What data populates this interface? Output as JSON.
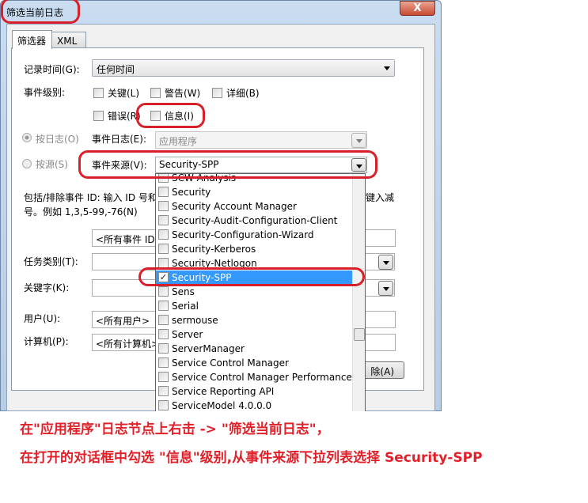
{
  "window": {
    "title": "筛选当前日志",
    "close_label": "X"
  },
  "tabs": [
    {
      "label": "筛选器",
      "active": true
    },
    {
      "label": "XML",
      "active": false
    }
  ],
  "filter": {
    "logged_label": "记录时间(G):",
    "logged_value": "任何时间",
    "level_label": "事件级别:",
    "levels": [
      {
        "label": "关键(L)",
        "checked": false
      },
      {
        "label": "警告(W)",
        "checked": false
      },
      {
        "label": "详细(B)",
        "checked": false
      },
      {
        "label": "错误(R)",
        "checked": false
      },
      {
        "label": "信息(I)",
        "checked": false
      }
    ],
    "by_log_label": "按日志(O)",
    "by_source_label": "按源(S)",
    "event_log_label": "事件日志(E):",
    "event_log_value": "应用程序",
    "event_source_label": "事件来源(V):",
    "event_source_value": "Security-SPP",
    "include_text_1": "包括/排除事件 ID: 输入 ID 号和",
    "include_text_1_tail": "键入减",
    "include_text_2": "号。例如 1,3,5-99,-76(N)",
    "event_id_placeholder": "<所有事件 ID>",
    "task_category_label": "任务类别(T):",
    "keywords_label": "关键字(K):",
    "user_label": "用户(U):",
    "user_value": "<所有用户>",
    "computer_label": "计算机(P):",
    "computer_value": "<所有计算机>",
    "clear_label": "除(A)"
  },
  "source_list": {
    "items": [
      {
        "label": "SCW Analysis",
        "checked": false
      },
      {
        "label": "Security",
        "checked": false
      },
      {
        "label": "Security Account Manager",
        "checked": false
      },
      {
        "label": "Security-Audit-Configuration-Client",
        "checked": false
      },
      {
        "label": "Security-Configuration-Wizard",
        "checked": false
      },
      {
        "label": "Security-Kerberos",
        "checked": false
      },
      {
        "label": "Security-Netlogon",
        "checked": false
      },
      {
        "label": "Security-SPP",
        "checked": true,
        "selected": true
      },
      {
        "label": "Sens",
        "checked": false
      },
      {
        "label": "Serial",
        "checked": false
      },
      {
        "label": "sermouse",
        "checked": false
      },
      {
        "label": "Server",
        "checked": false
      },
      {
        "label": "ServerManager",
        "checked": false
      },
      {
        "label": "Service Control Manager",
        "checked": false
      },
      {
        "label": "Service Control Manager Performance",
        "checked": false
      },
      {
        "label": "Service Reporting API",
        "checked": false
      },
      {
        "label": "ServiceModel 4.0.0.0",
        "checked": false
      }
    ]
  },
  "annotation": {
    "line1": "在\"应用程序\"日志节点上右击 -> \"筛选当前日志\"，",
    "line2": "在打开的对话框中勾选 \"信息\"级别,从事件来源下拉列表选择 Security-SPP",
    "color": "#e0212a"
  }
}
